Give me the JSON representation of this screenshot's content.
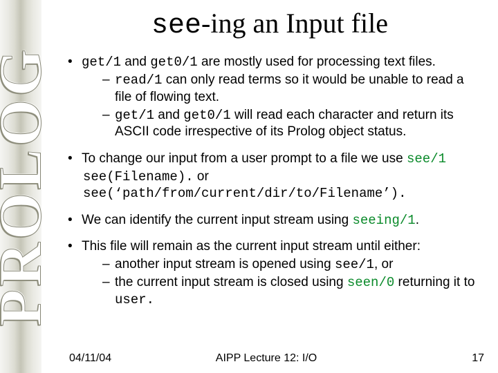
{
  "sidebar": {
    "label": "PROLOG"
  },
  "title": {
    "mono": "see",
    "rest": "-ing an Input file"
  },
  "b1": {
    "t1": "get/1",
    "t2": " and ",
    "t3": "get0/1",
    "t4": " are mostly used for processing text files.",
    "s1a": "read/1",
    "s1b": " can only read terms so it would be unable to read a file of flowing text.",
    "s2a": "get/1",
    "s2b": " and ",
    "s2c": "get0/1",
    "s2d": " will read each character and return its ASCII code irrespective of its Prolog object status."
  },
  "b2": {
    "t1": "To change our input from a user prompt to a file we use ",
    "see1": "see/1",
    "line2a": "see(Filename).",
    "line2b": "  or",
    "line3": "see(‘path/from/current/dir/to/Filename’)."
  },
  "b3": {
    "t1": "We can identify the current input stream using ",
    "seeing": "seeing/1",
    "dot": "."
  },
  "b4": {
    "t1": "This file will remain as the current input stream until either:",
    "s1a": "another input stream is opened using ",
    "s1b": "see/1",
    "s1c": ", or",
    "s2a": "the current input stream is closed using ",
    "s2b": "seen/0",
    "s2c": " returning it to ",
    "s2d": "user."
  },
  "footer": {
    "date": "04/11/04",
    "lecture": "AIPP Lecture 12: I/O",
    "page": "17"
  }
}
